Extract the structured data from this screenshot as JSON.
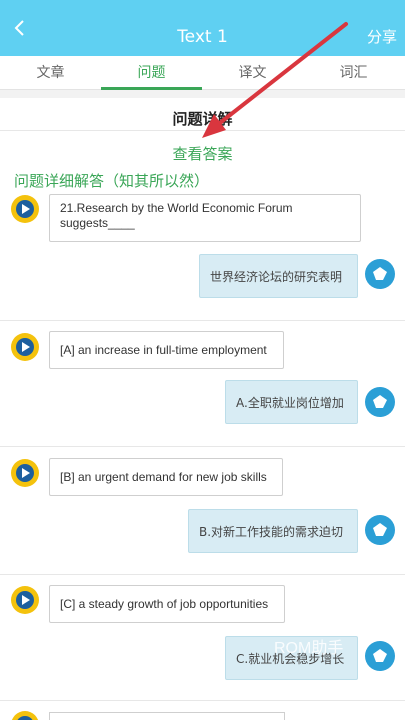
{
  "header": {
    "title": "Text 1",
    "share_label": "分享"
  },
  "tabs": [
    {
      "label": "文章"
    },
    {
      "label": "问题"
    },
    {
      "label": "译文"
    },
    {
      "label": "词汇"
    }
  ],
  "active_tab": "问题",
  "section_title": "问题详解",
  "view_answer_label": "查看答案",
  "sub_title": "问题详细解答（知其所以然）",
  "qa": [
    {
      "question": "21.Research by the World Economic Forum suggests____",
      "answer": "世界经济论坛的研究表明"
    },
    {
      "question": "[A] an increase in full-time employment",
      "answer": "A.全职就业岗位增加"
    },
    {
      "question": "[B] an urgent demand for new job skills",
      "answer": "B.对新工作技能的需求迫切"
    },
    {
      "question": "[C] a steady growth of job opportunities",
      "answer": "C.就业机会稳步增长"
    }
  ],
  "watermark": "ROM助手",
  "colors": {
    "header": "#5fd0f2",
    "accent": "#3aa657",
    "answer_bubble": "#d8ecf4",
    "arrow": "#d9363e"
  }
}
